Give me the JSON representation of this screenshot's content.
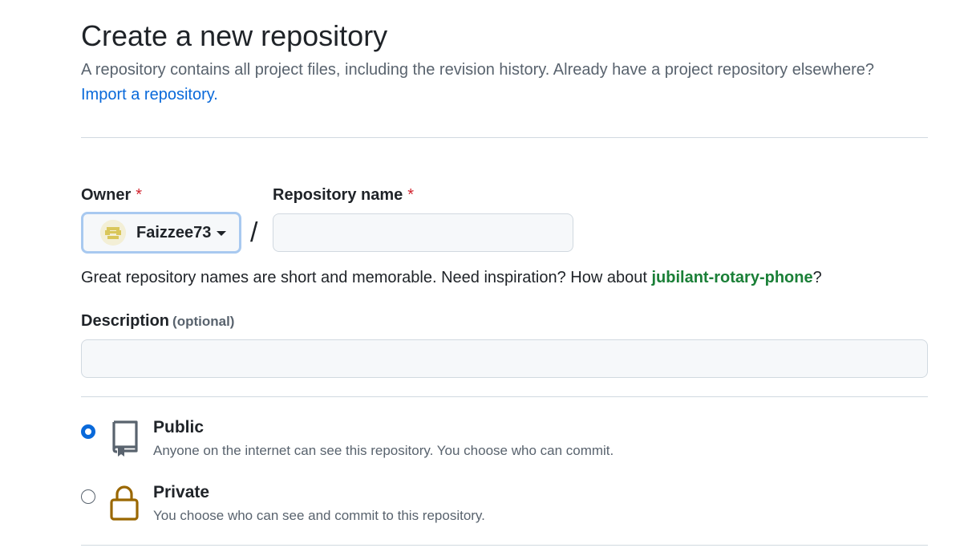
{
  "header": {
    "title": "Create a new repository",
    "subtitle": "A repository contains all project files, including the revision history. Already have a project repository elsewhere?",
    "import_link": "Import a repository."
  },
  "owner": {
    "label": "Owner",
    "required_mark": "*",
    "selected": "Faizzee73",
    "avatar_icon": "identicon-avatar"
  },
  "repo_name": {
    "label": "Repository name",
    "required_mark": "*",
    "value": "",
    "separator": "/"
  },
  "hint": {
    "prefix": "Great repository names are short and memorable. Need inspiration? How about ",
    "suggestion": "jubilant-rotary-phone",
    "suffix": "?"
  },
  "description": {
    "label": "Description",
    "optional": "(optional)",
    "value": ""
  },
  "visibility": {
    "options": [
      {
        "title": "Public",
        "description": "Anyone on the internet can see this repository. You choose who can commit.",
        "icon": "repo-book-icon",
        "checked": true
      },
      {
        "title": "Private",
        "description": "You choose who can see and commit to this repository.",
        "icon": "lock-icon",
        "checked": false
      }
    ]
  },
  "colors": {
    "link": "#0969da",
    "suggestion": "#1a7f37",
    "required": "#d1242f",
    "lock": "#9a6700",
    "focus_ring": "#a8c9f0"
  }
}
